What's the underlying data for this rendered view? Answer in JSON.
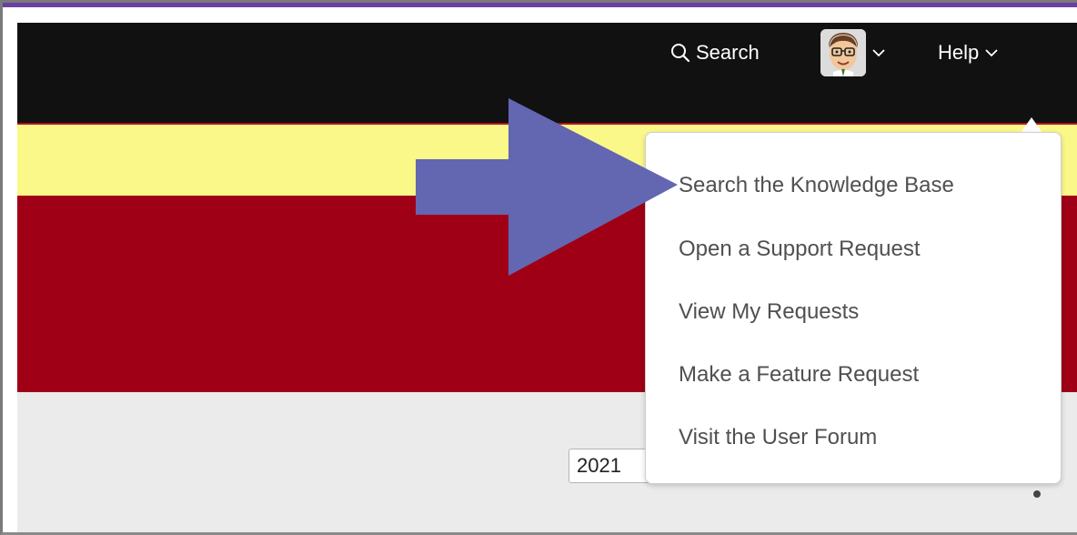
{
  "navbar": {
    "search_label": "Search",
    "help_label": "Help",
    "icons": {
      "search": "search-icon",
      "chevron": "chevron-down-icon",
      "avatar": "avatar"
    }
  },
  "help_menu": {
    "items": [
      {
        "label": "Search the Knowledge Base"
      },
      {
        "label": "Open a Support Request"
      },
      {
        "label": "View My Requests"
      },
      {
        "label": "Make a Feature Request"
      },
      {
        "label": "Visit the User Forum"
      }
    ]
  },
  "content": {
    "year_value": "2021"
  },
  "colors": {
    "navbar": "#111111",
    "yellow_band": "#fbf88a",
    "red_band": "#a00016",
    "arrow": "#6366b1",
    "page_bg": "#ebebeb"
  }
}
